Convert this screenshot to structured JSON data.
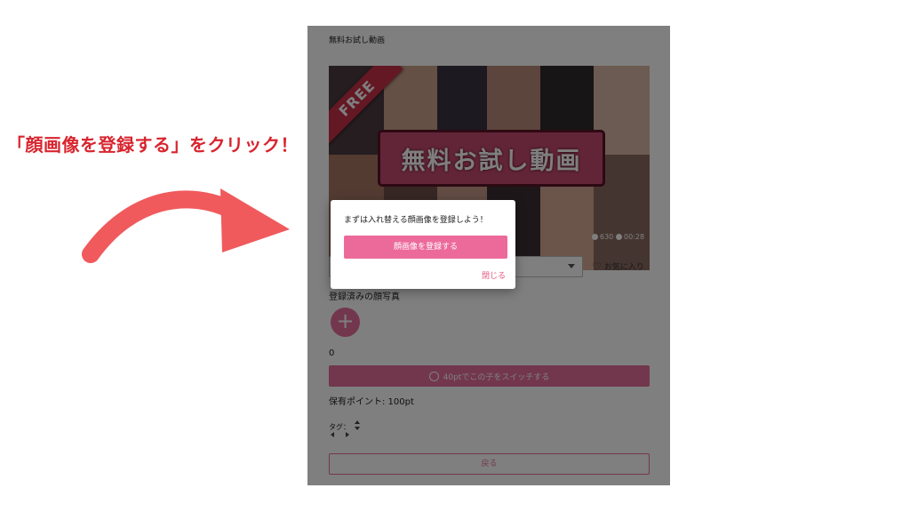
{
  "annotation": {
    "instruction": "「顔画像を登録する」をクリック！",
    "color": "#d8252f"
  },
  "page": {
    "title": "無料お試し動画"
  },
  "thumbnail": {
    "banner_text": "無料お試し動画",
    "ribbon_text": "FREE",
    "views": "630",
    "duration": "00:28"
  },
  "controls": {
    "favorite_label": "お気に入り"
  },
  "faces": {
    "label": "登録済みの顔写真",
    "add_symbol": "+",
    "count": "0"
  },
  "switch": {
    "label": "40ptでこの子をスイッチする"
  },
  "points": {
    "text": "保有ポイント: 100pt"
  },
  "tags": {
    "label": "タグ："
  },
  "back": {
    "label": "戻る"
  },
  "modal": {
    "message": "まずは入れ替える顔画像を登録しよう！",
    "primary_label": "顔画像を登録する",
    "close_label": "閉じる"
  },
  "colors": {
    "accent": "#e46f9b",
    "arrow": "#f05a5c",
    "overlay": "rgba(0,0,0,0.5)"
  }
}
